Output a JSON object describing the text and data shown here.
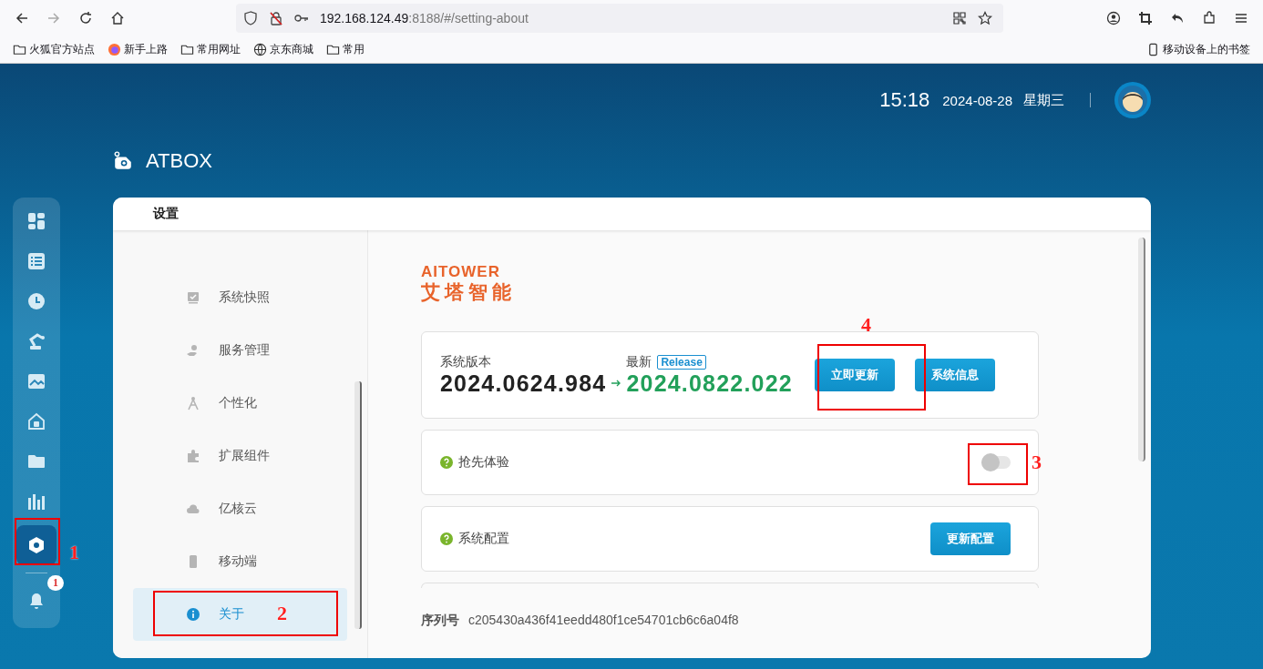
{
  "browser": {
    "url_host": "192.168.124.49",
    "url_rest": ":8188/#/setting-about",
    "bookmarks": [
      {
        "label": "火狐官方站点",
        "kind": "folder"
      },
      {
        "label": "新手上路",
        "kind": "firefox"
      },
      {
        "label": "常用网址",
        "kind": "folder"
      },
      {
        "label": "京东商城",
        "kind": "globe"
      },
      {
        "label": "常用",
        "kind": "folder"
      }
    ],
    "mobile_bookmarks": "移动设备上的书签"
  },
  "header": {
    "time": "15:18",
    "date": "2024-08-28",
    "weekday": "星期三"
  },
  "app_title": "ATBOX",
  "rail": {
    "items": [
      {
        "kind": "dashboard",
        "selected": false
      },
      {
        "kind": "list",
        "selected": false
      },
      {
        "kind": "history",
        "selected": false
      },
      {
        "kind": "robot",
        "selected": false
      },
      {
        "kind": "image",
        "selected": false
      },
      {
        "kind": "home",
        "selected": false
      },
      {
        "kind": "folder",
        "selected": false
      },
      {
        "kind": "chart",
        "selected": false
      },
      {
        "kind": "settings",
        "selected": true
      }
    ],
    "notification_count": "1"
  },
  "settings": {
    "title": "设置",
    "menu": [
      {
        "label": "系统快照",
        "kind": "snapshot",
        "selected": false
      },
      {
        "label": "服务管理",
        "kind": "service",
        "selected": false
      },
      {
        "label": "个性化",
        "kind": "personal",
        "selected": false
      },
      {
        "label": "扩展组件",
        "kind": "puzzle",
        "selected": false
      },
      {
        "label": "亿核云",
        "kind": "cloud",
        "selected": false
      },
      {
        "label": "移动端",
        "kind": "mobile",
        "selected": false
      },
      {
        "label": "关于",
        "kind": "info",
        "selected": true
      }
    ],
    "brand_latin": "AITOWER",
    "brand_chinese": "艾塔智能",
    "version": {
      "current_label": "系统版本",
      "current": "2024.0624.984",
      "latest_label": "最新",
      "channel": "Release",
      "latest": "2024.0822.022",
      "buttons": [
        "立即更新",
        "系统信息"
      ]
    },
    "early_access": {
      "label": "抢先体验",
      "on": false
    },
    "config": {
      "label": "系统配置",
      "button": "更新配置"
    },
    "serial_label": "序列号",
    "serial": "c205430a436f41eedd480f1ce54701cb6c6a04f8"
  },
  "annotations": [
    "1",
    "2",
    "3",
    "4"
  ]
}
